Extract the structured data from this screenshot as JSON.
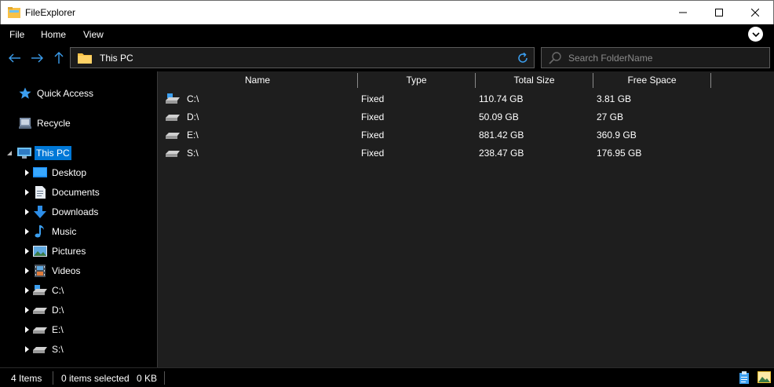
{
  "window": {
    "title": "FileExplorer"
  },
  "menu": {
    "items": [
      "File",
      "Home",
      "View"
    ]
  },
  "address": {
    "path": "This PC"
  },
  "search": {
    "placeholder": "Search FolderName",
    "value": ""
  },
  "sidebar": {
    "quick_access": "Quick Access",
    "recycle": "Recycle",
    "this_pc": "This PC",
    "children": [
      "Desktop",
      "Documents",
      "Downloads",
      "Music",
      "Pictures",
      "Videos",
      "C:\\",
      "D:\\",
      "E:\\",
      "S:\\"
    ]
  },
  "table": {
    "columns": [
      "Name",
      "Type",
      "Total Size",
      "Free Space"
    ],
    "rows": [
      {
        "name": "C:\\",
        "type": "Fixed",
        "total": "110.74 GB",
        "free": "3.81 GB"
      },
      {
        "name": "D:\\",
        "type": "Fixed",
        "total": "50.09 GB",
        "free": "27 GB"
      },
      {
        "name": "E:\\",
        "type": "Fixed",
        "total": "881.42 GB",
        "free": "360.9 GB"
      },
      {
        "name": "S:\\",
        "type": "Fixed",
        "total": "238.47 GB",
        "free": "176.95 GB"
      }
    ]
  },
  "status": {
    "items": "4 Items",
    "selected": "0 items selected",
    "size": "0 KB"
  },
  "colors": {
    "accent": "#0078d7",
    "panel": "#1e1e1e",
    "folder": "#f8c146"
  }
}
